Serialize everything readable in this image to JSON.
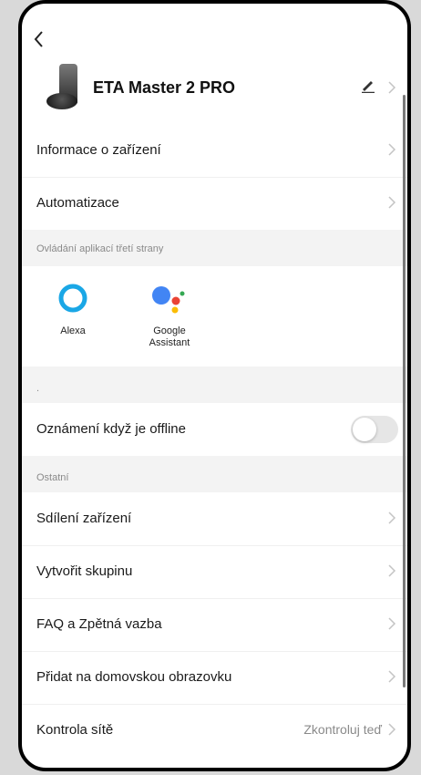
{
  "header": {
    "device_name": "ETA Master 2 PRO"
  },
  "rows": {
    "device_info": "Informace o zařízení",
    "automation": "Automatizace",
    "offline_notification": "Oznámení když je offline",
    "share_device": "Sdílení zařízení",
    "create_group": "Vytvořit skupinu",
    "faq": "FAQ a Zpětná vazba",
    "add_home": "Přidat na domovskou obrazovku",
    "network_check": "Kontrola sítě",
    "network_check_value": "Zkontroluj teď"
  },
  "sections": {
    "third_party": "Ovládání aplikací třetí strany",
    "dot": ".",
    "other": "Ostatní"
  },
  "third_party_items": {
    "alexa": "Alexa",
    "google_line1": "Google",
    "google_line2": "Assistant"
  },
  "toggles": {
    "offline_notification_on": false
  },
  "colors": {
    "alexa": "#1AA7E6",
    "google_blue": "#4285F4",
    "google_red": "#EA4335",
    "google_yellow": "#FBBC05",
    "google_green": "#34A853"
  }
}
